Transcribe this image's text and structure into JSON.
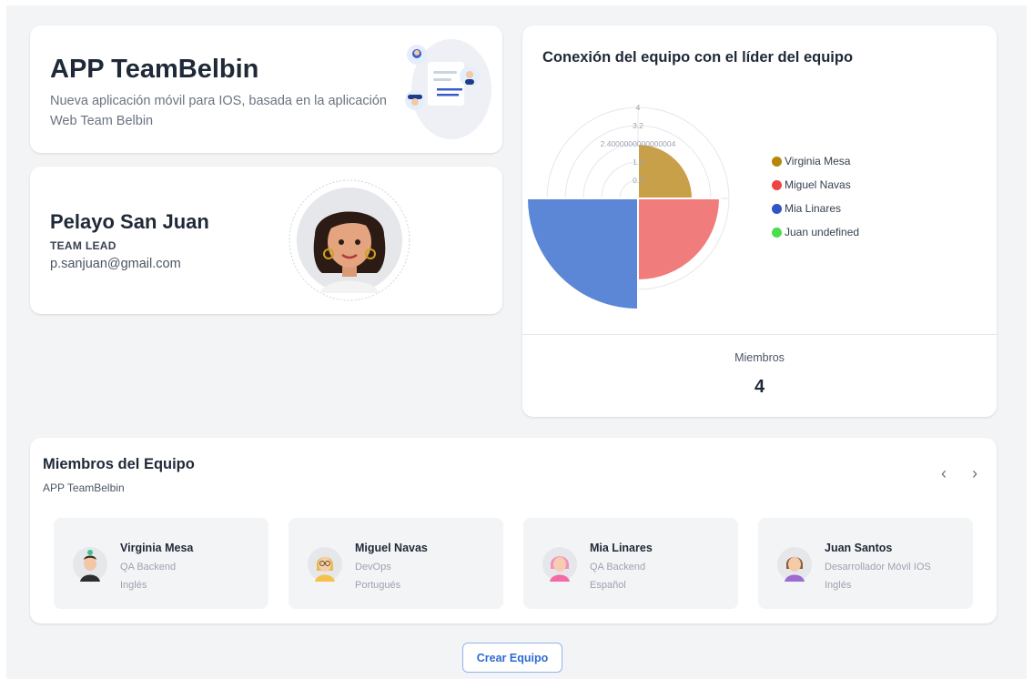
{
  "project": {
    "title": "APP TeamBelbin",
    "description": "Nueva aplicación móvil para IOS, basada en la aplicación Web Team Belbin",
    "illustration_icon": "team-document-illustration-icon"
  },
  "leader": {
    "name": "Pelayo San Juan",
    "role": "TEAM LEAD",
    "email": "p.sanjuan@gmail.com",
    "avatar_icon": "woman-avatar-icon"
  },
  "chart_card": {
    "title": "Conexión del equipo con el líder del equipo",
    "members_label": "Miembros",
    "members_count": "4"
  },
  "chart_data": {
    "type": "polar-area",
    "title": "Conexión del equipo con el líder del equipo",
    "categories": [
      "Virginia Mesa",
      "Miguel Navas",
      "Mia Linares",
      "Juan undefined"
    ],
    "values": [
      2.4,
      3.6,
      5,
      0
    ],
    "colors": [
      "#c9a04a",
      "#f07c7c",
      "#5b87d6",
      "#54c94a"
    ],
    "legend_colors": [
      "#b8860b",
      "#ef4444",
      "#2f55c6",
      "#4ade4a"
    ],
    "radial_ticks": [
      "0.8",
      "1.6",
      "2.4000000000000004",
      "3.2",
      "4"
    ],
    "r_max": 4,
    "legend_position": "right",
    "grid": true
  },
  "team": {
    "title": "Miembros del Equipo",
    "subtitle": "APP TeamBelbin",
    "prev_icon": "chevron-left-icon",
    "next_icon": "chevron-right-icon",
    "prev_label": "‹",
    "next_label": "›",
    "members": [
      {
        "name": "Virginia Mesa",
        "role": "QA Backend",
        "language": "Inglés",
        "avatar_icon": "man-avatar-icon"
      },
      {
        "name": "Miguel Navas",
        "role": "DevOps",
        "language": "Portugués",
        "avatar_icon": "woman-glasses-avatar-icon"
      },
      {
        "name": "Mia Linares",
        "role": "QA Backend",
        "language": "Español",
        "avatar_icon": "pink-hair-avatar-icon"
      },
      {
        "name": "Juan Santos",
        "role": "Desarrollador Móvil IOS",
        "language": "Inglés",
        "avatar_icon": "woman-purple-avatar-icon"
      }
    ]
  },
  "actions": {
    "create_label": "Crear Equipo"
  }
}
